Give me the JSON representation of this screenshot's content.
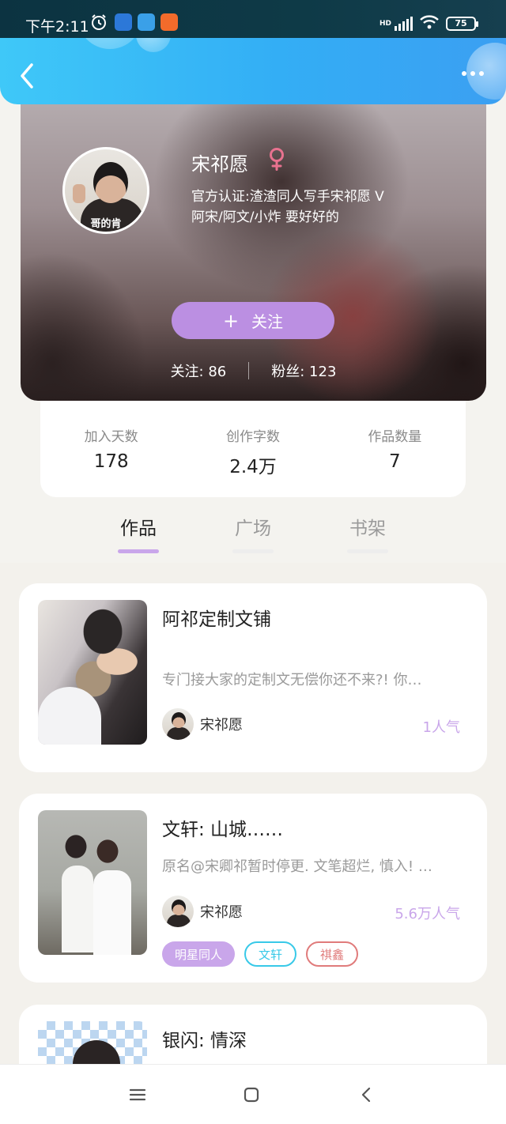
{
  "status_bar": {
    "time": "下午2:11",
    "battery": "75",
    "network_label": "HD"
  },
  "app_bar": {
    "back_icon": "chevron-left-icon",
    "more_icon": "more-dots-icon"
  },
  "profile": {
    "name": "宋祁愿",
    "gender": "female",
    "avatar_caption": "哥的肯",
    "verify_line1": "官方认证:渣渣同人写手宋祁愿 V",
    "verify_line2": "阿宋/阿文/小炸 要好好的",
    "follow_label": "关注",
    "follow_icon": "plus-icon",
    "following_label": "关注: 86",
    "followers_label": "粉丝: 123"
  },
  "stats": [
    {
      "label": "加入天数",
      "value": "178"
    },
    {
      "label": "创作字数",
      "value": "2.4万"
    },
    {
      "label": "作品数量",
      "value": "7"
    }
  ],
  "tabs": [
    {
      "label": "作品",
      "active": true
    },
    {
      "label": "广场",
      "active": false
    },
    {
      "label": "书架",
      "active": false
    }
  ],
  "works": [
    {
      "title": "阿祁定制文铺",
      "desc": "专门接大家的定制文无偿你还不来?! 你…",
      "author": "宋祁愿",
      "popularity": "1人气",
      "tags": []
    },
    {
      "title": "文轩: 山城……",
      "desc": "原名@宋卿祁暂时停更. 文笔超烂, 慎入! …",
      "author": "宋祁愿",
      "popularity": "5.6万人气",
      "tags": [
        "明星同人",
        "文轩",
        "祺鑫"
      ]
    },
    {
      "title": "银闪: 情深",
      "desc": "",
      "author": "",
      "popularity": "",
      "tags": []
    }
  ],
  "colors": {
    "accent_purple": "#bb8fe2",
    "topbar_blue": "#33aef5",
    "gender_pink": "#e8728f",
    "tag_cyan": "#38c9e8",
    "tag_red": "#e07b7b"
  },
  "nav": {
    "menu_icon": "menu-icon",
    "home_icon": "home-square-icon",
    "back_icon": "back-chevron-icon"
  }
}
